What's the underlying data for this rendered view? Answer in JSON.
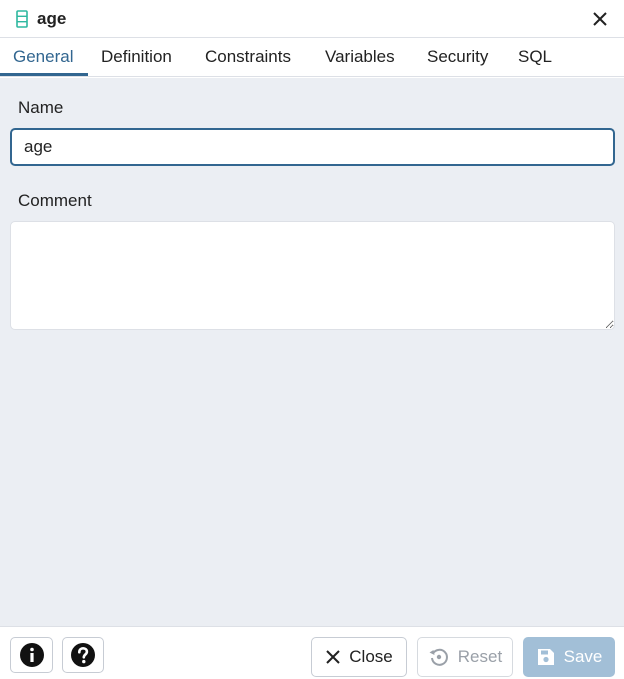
{
  "dialog": {
    "title": "age",
    "icon": "column-icon",
    "close_icon": "close-icon"
  },
  "tabs": [
    {
      "label": "General",
      "active": true
    },
    {
      "label": "Definition",
      "active": false
    },
    {
      "label": "Constraints",
      "active": false
    },
    {
      "label": "Variables",
      "active": false
    },
    {
      "label": "Security",
      "active": false
    },
    {
      "label": "SQL",
      "active": false
    }
  ],
  "form": {
    "name_label": "Name",
    "name_value": "age",
    "comment_label": "Comment",
    "comment_value": ""
  },
  "footer": {
    "info_icon": "info-icon",
    "help_icon": "help-icon",
    "close_label": "Close",
    "reset_label": "Reset",
    "save_label": "Save"
  },
  "colors": {
    "accent": "#326690",
    "content_bg": "#ebeef3",
    "save_bg": "#a2bfd7",
    "icon_teal": "#2eb8a0"
  }
}
